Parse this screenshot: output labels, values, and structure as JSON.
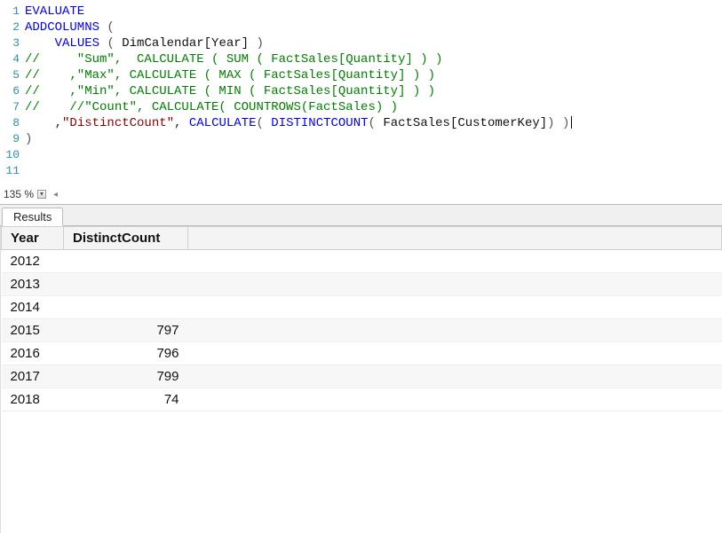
{
  "editor": {
    "lines": [
      {
        "n": 1,
        "tokens": [
          {
            "t": "EVALUATE",
            "c": "tok-func"
          }
        ]
      },
      {
        "n": 2,
        "tokens": [
          {
            "t": "ADDCOLUMNS",
            "c": "tok-func"
          },
          {
            "t": " ",
            "c": ""
          },
          {
            "t": "(",
            "c": "tok-paren"
          }
        ]
      },
      {
        "n": 3,
        "tokens": [
          {
            "t": "    ",
            "c": ""
          },
          {
            "t": "VALUES",
            "c": "tok-func"
          },
          {
            "t": " ",
            "c": ""
          },
          {
            "t": "(",
            "c": "tok-paren"
          },
          {
            "t": " DimCalendar[Year] ",
            "c": "tok-table"
          },
          {
            "t": ")",
            "c": "tok-paren"
          }
        ]
      },
      {
        "n": 4,
        "tokens": [
          {
            "t": "//     \"Sum\",  CALCULATE ( SUM ( FactSales[Quantity] ) )",
            "c": "tok-comment"
          }
        ]
      },
      {
        "n": 5,
        "tokens": [
          {
            "t": "//    ,\"Max\", CALCULATE ( MAX ( FactSales[Quantity] ) )",
            "c": "tok-comment"
          }
        ]
      },
      {
        "n": 6,
        "tokens": [
          {
            "t": "//    ,\"Min\", CALCULATE ( MIN ( FactSales[Quantity] ) )",
            "c": "tok-comment"
          }
        ]
      },
      {
        "n": 7,
        "tokens": [
          {
            "t": "//    //\"Count\", CALCULATE( COUNTROWS(FactSales) )",
            "c": "tok-comment"
          }
        ]
      },
      {
        "n": 8,
        "tokens": [
          {
            "t": "    ",
            "c": ""
          },
          {
            "t": ",",
            "c": "tok-punct"
          },
          {
            "t": "\"DistinctCount\"",
            "c": "tok-str"
          },
          {
            "t": ", ",
            "c": "tok-punct"
          },
          {
            "t": "CALCULATE",
            "c": "tok-func"
          },
          {
            "t": "( ",
            "c": "tok-paren"
          },
          {
            "t": "DISTINCTCOUNT",
            "c": "tok-func"
          },
          {
            "t": "( ",
            "c": "tok-paren"
          },
          {
            "t": "FactSales[CustomerKey]",
            "c": "tok-table"
          },
          {
            "t": ") )",
            "c": "tok-paren"
          }
        ]
      },
      {
        "n": 9,
        "tokens": [
          {
            "t": ")",
            "c": "tok-paren"
          }
        ]
      },
      {
        "n": 10,
        "tokens": []
      },
      {
        "n": 11,
        "tokens": []
      }
    ],
    "cursor_line": 8
  },
  "zoom": {
    "value": "135 %"
  },
  "results": {
    "tab_label": "Results",
    "columns": [
      "Year",
      "DistinctCount"
    ],
    "rows": [
      {
        "Year": "2012",
        "DistinctCount": ""
      },
      {
        "Year": "2013",
        "DistinctCount": ""
      },
      {
        "Year": "2014",
        "DistinctCount": ""
      },
      {
        "Year": "2015",
        "DistinctCount": "797"
      },
      {
        "Year": "2016",
        "DistinctCount": "796"
      },
      {
        "Year": "2017",
        "DistinctCount": "799"
      },
      {
        "Year": "2018",
        "DistinctCount": "74"
      }
    ]
  }
}
